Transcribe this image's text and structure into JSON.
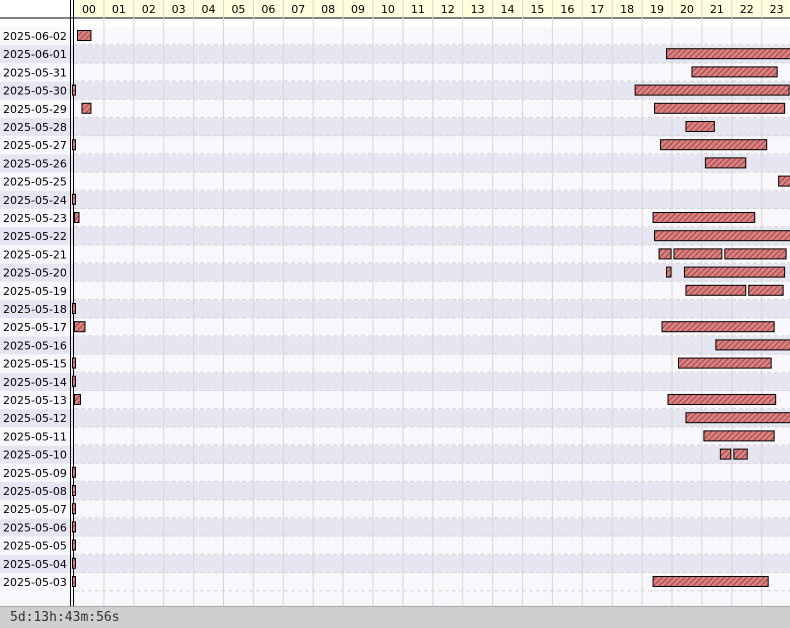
{
  "chart_data": {
    "type": "gantt",
    "x_unit": "hour of day",
    "xlim": [
      0,
      24
    ],
    "hours": [
      "00",
      "01",
      "02",
      "03",
      "04",
      "05",
      "06",
      "07",
      "08",
      "09",
      "10",
      "11",
      "12",
      "13",
      "14",
      "15",
      "16",
      "17",
      "18",
      "19",
      "20",
      "21",
      "22",
      "23"
    ],
    "rows": [
      {
        "date": "2025-06-02",
        "intervals": [
          [
            0.1,
            0.55
          ]
        ]
      },
      {
        "date": "2025-06-01",
        "intervals": [
          [
            19.8,
            24.0
          ]
        ]
      },
      {
        "date": "2025-05-31",
        "intervals": [
          [
            20.65,
            23.5
          ]
        ]
      },
      {
        "date": "2025-05-30",
        "intervals": [
          [
            0.0,
            0.05
          ],
          [
            18.75,
            23.9
          ]
        ]
      },
      {
        "date": "2025-05-29",
        "intervals": [
          [
            0.25,
            0.55
          ],
          [
            19.4,
            23.75
          ]
        ]
      },
      {
        "date": "2025-05-28",
        "intervals": [
          [
            20.45,
            21.4
          ]
        ]
      },
      {
        "date": "2025-05-27",
        "intervals": [
          [
            0.0,
            0.05
          ],
          [
            19.6,
            23.15
          ]
        ]
      },
      {
        "date": "2025-05-26",
        "intervals": [
          [
            21.1,
            22.45
          ]
        ]
      },
      {
        "date": "2025-05-25",
        "intervals": [
          [
            23.55,
            24.0
          ]
        ]
      },
      {
        "date": "2025-05-24",
        "intervals": [
          [
            0.0,
            0.05
          ]
        ]
      },
      {
        "date": "2025-05-23",
        "intervals": [
          [
            0.0,
            0.15
          ],
          [
            19.35,
            22.75
          ]
        ]
      },
      {
        "date": "2025-05-22",
        "intervals": [
          [
            19.4,
            24.0
          ]
        ]
      },
      {
        "date": "2025-05-21",
        "intervals": [
          [
            19.55,
            19.95
          ],
          [
            20.05,
            21.65
          ],
          [
            21.75,
            23.8
          ]
        ]
      },
      {
        "date": "2025-05-20",
        "intervals": [
          [
            19.8,
            19.95
          ],
          [
            20.4,
            23.75
          ]
        ]
      },
      {
        "date": "2025-05-19",
        "intervals": [
          [
            20.45,
            22.45
          ],
          [
            22.55,
            23.7
          ]
        ]
      },
      {
        "date": "2025-05-18",
        "intervals": [
          [
            0.0,
            0.05
          ]
        ]
      },
      {
        "date": "2025-05-17",
        "intervals": [
          [
            0.0,
            0.35
          ],
          [
            19.65,
            23.4
          ]
        ]
      },
      {
        "date": "2025-05-16",
        "intervals": [
          [
            21.45,
            24.0
          ]
        ]
      },
      {
        "date": "2025-05-15",
        "intervals": [
          [
            0.0,
            0.05
          ],
          [
            20.2,
            23.3
          ]
        ]
      },
      {
        "date": "2025-05-14",
        "intervals": [
          [
            0.0,
            0.05
          ]
        ]
      },
      {
        "date": "2025-05-13",
        "intervals": [
          [
            0.0,
            0.2
          ],
          [
            19.85,
            23.45
          ]
        ]
      },
      {
        "date": "2025-05-12",
        "intervals": [
          [
            20.45,
            24.0
          ]
        ]
      },
      {
        "date": "2025-05-11",
        "intervals": [
          [
            21.05,
            23.4
          ]
        ]
      },
      {
        "date": "2025-05-10",
        "intervals": [
          [
            21.6,
            21.95
          ],
          [
            22.05,
            22.5
          ]
        ]
      },
      {
        "date": "2025-05-09",
        "intervals": [
          [
            0.0,
            0.05
          ]
        ]
      },
      {
        "date": "2025-05-08",
        "intervals": [
          [
            0.0,
            0.05
          ]
        ]
      },
      {
        "date": "2025-05-07",
        "intervals": [
          [
            0.0,
            0.05
          ]
        ]
      },
      {
        "date": "2025-05-06",
        "intervals": [
          [
            0.0,
            0.05
          ]
        ]
      },
      {
        "date": "2025-05-05",
        "intervals": [
          [
            0.0,
            0.05
          ]
        ]
      },
      {
        "date": "2025-05-04",
        "intervals": [
          [
            0.0,
            0.05
          ]
        ]
      },
      {
        "date": "2025-05-03",
        "intervals": [
          [
            0.0,
            0.05
          ],
          [
            19.35,
            23.2
          ]
        ]
      }
    ]
  },
  "footer": {
    "total_duration": "5d:13h:43m:56s"
  },
  "colors": {
    "bar_fill": "#d98080",
    "bar_stroke": "#000000",
    "bar_hatch": "#8b2e2e",
    "header_bg": "#ffffe0",
    "row_light": "#f8f8fc",
    "row_dark": "#e6e6f3",
    "grid": "#d6d6d6",
    "footer_bg": "#cfcfcf"
  }
}
